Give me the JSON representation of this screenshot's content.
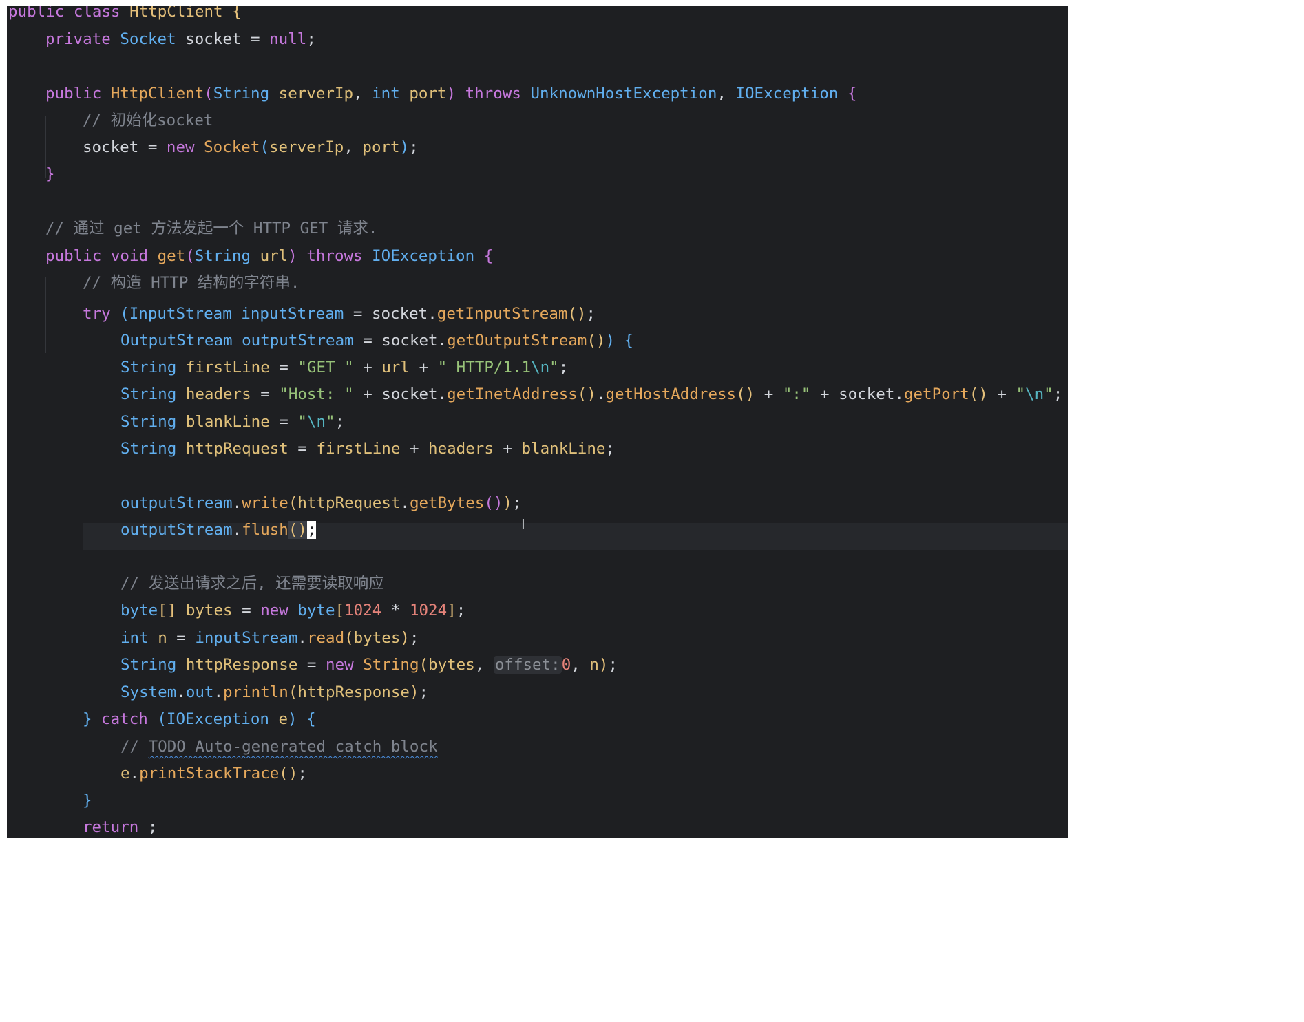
{
  "editor": {
    "theme": {
      "background": "#1e1f22",
      "keyword": "#c678dd",
      "type": "#61afef",
      "string": "#98c379",
      "comment": "#7f848e",
      "method": "#e5a85c"
    },
    "lines": [
      {
        "indent": 0,
        "tokens": [
          [
            "kw",
            "public"
          ],
          [
            "plain",
            " "
          ],
          [
            "kw",
            "class"
          ],
          [
            "plain",
            " "
          ],
          [
            "cls",
            "HttpClient"
          ],
          [
            "plain",
            " "
          ],
          [
            "br1",
            "{"
          ]
        ]
      },
      {
        "indent": 1,
        "tokens": [
          [
            "kw",
            "private"
          ],
          [
            "plain",
            " "
          ],
          [
            "ty",
            "Socket"
          ],
          [
            "plain",
            " socket = "
          ],
          [
            "kw",
            "null"
          ],
          [
            "plain",
            ";"
          ]
        ]
      },
      {
        "indent": 0,
        "tokens": []
      },
      {
        "indent": 1,
        "tokens": [
          [
            "kw",
            "public"
          ],
          [
            "plain",
            " "
          ],
          [
            "fn",
            "HttpClient"
          ],
          [
            "br2",
            "("
          ],
          [
            "ty",
            "String"
          ],
          [
            "plain",
            " "
          ],
          [
            "var",
            "serverIp"
          ],
          [
            "plain",
            ", "
          ],
          [
            "ty",
            "int"
          ],
          [
            "plain",
            " "
          ],
          [
            "var",
            "port"
          ],
          [
            "br2",
            ")"
          ],
          [
            "plain",
            " "
          ],
          [
            "kw",
            "throws"
          ],
          [
            "plain",
            " "
          ],
          [
            "ty",
            "UnknownHostException"
          ],
          [
            "plain",
            ", "
          ],
          [
            "ty",
            "IOException"
          ],
          [
            "plain",
            " "
          ],
          [
            "br2",
            "{"
          ]
        ]
      },
      {
        "indent": 2,
        "tokens": [
          [
            "cmt",
            "// 初始化socket"
          ]
        ]
      },
      {
        "indent": 2,
        "tokens": [
          [
            "plain",
            "socket = "
          ],
          [
            "kw",
            "new"
          ],
          [
            "plain",
            " "
          ],
          [
            "fn",
            "Socket"
          ],
          [
            "br3",
            "("
          ],
          [
            "var",
            "serverIp"
          ],
          [
            "plain",
            ", "
          ],
          [
            "var",
            "port"
          ],
          [
            "br3",
            ")"
          ],
          [
            "plain",
            ";"
          ]
        ]
      },
      {
        "indent": 1,
        "tokens": [
          [
            "br2",
            "}"
          ]
        ]
      },
      {
        "indent": 0,
        "tokens": []
      },
      {
        "indent": 1,
        "tokens": [
          [
            "cmt",
            "// 通过 get 方法发起一个 HTTP GET 请求."
          ]
        ]
      },
      {
        "indent": 1,
        "tokens": [
          [
            "kw",
            "public"
          ],
          [
            "plain",
            " "
          ],
          [
            "kw",
            "void"
          ],
          [
            "plain",
            " "
          ],
          [
            "fn",
            "get"
          ],
          [
            "br2",
            "("
          ],
          [
            "ty",
            "String"
          ],
          [
            "plain",
            " "
          ],
          [
            "var",
            "url"
          ],
          [
            "br2",
            ")"
          ],
          [
            "plain",
            " "
          ],
          [
            "kw",
            "throws"
          ],
          [
            "plain",
            " "
          ],
          [
            "ty",
            "IOException"
          ],
          [
            "plain",
            " "
          ],
          [
            "br2",
            "{"
          ]
        ]
      },
      {
        "indent": 2,
        "tokens": [
          [
            "cmt",
            "// 构造 HTTP 结构的字符串."
          ]
        ]
      },
      {
        "indent": 2,
        "tokens": [
          [
            "kw",
            "try"
          ],
          [
            "plain",
            " "
          ],
          [
            "br3",
            "("
          ],
          [
            "ty",
            "InputStream"
          ],
          [
            "plain",
            " "
          ],
          [
            "field",
            "inputStream"
          ],
          [
            "plain",
            " = socket."
          ],
          [
            "fn",
            "getInputStream"
          ],
          [
            "br1",
            "()"
          ],
          [
            "plain",
            ";"
          ]
        ]
      },
      {
        "indent": 3,
        "tokens": [
          [
            "ty",
            "OutputStream"
          ],
          [
            "plain",
            " "
          ],
          [
            "field",
            "outputStream"
          ],
          [
            "plain",
            " = socket."
          ],
          [
            "fn",
            "getOutputStream"
          ],
          [
            "br1",
            "()"
          ],
          [
            "br3",
            ")"
          ],
          [
            "plain",
            " "
          ],
          [
            "br3",
            "{"
          ]
        ]
      },
      {
        "indent": 3,
        "tokens": [
          [
            "ty",
            "String"
          ],
          [
            "plain",
            " "
          ],
          [
            "var",
            "firstLine"
          ],
          [
            "plain",
            " = "
          ],
          [
            "str",
            "\"GET \""
          ],
          [
            "plain",
            " + "
          ],
          [
            "var",
            "url"
          ],
          [
            "plain",
            " + "
          ],
          [
            "str",
            "\" HTTP/1.1"
          ],
          [
            "esc",
            "\\n"
          ],
          [
            "str",
            "\""
          ],
          [
            "plain",
            ";"
          ]
        ]
      },
      {
        "indent": 3,
        "tokens": [
          [
            "ty",
            "String"
          ],
          [
            "plain",
            " "
          ],
          [
            "var",
            "headers"
          ],
          [
            "plain",
            " = "
          ],
          [
            "str",
            "\"Host: \""
          ],
          [
            "plain",
            " + socket."
          ],
          [
            "fn",
            "getInetAddress"
          ],
          [
            "br1",
            "()"
          ],
          [
            "plain",
            "."
          ],
          [
            "fn",
            "getHostAddress"
          ],
          [
            "br1",
            "()"
          ],
          [
            "plain",
            " + "
          ],
          [
            "str",
            "\":\""
          ],
          [
            "plain",
            " + socket."
          ],
          [
            "fn",
            "getPort"
          ],
          [
            "br1",
            "()"
          ],
          [
            "plain",
            " + "
          ],
          [
            "str",
            "\""
          ],
          [
            "esc",
            "\\n"
          ],
          [
            "str",
            "\""
          ],
          [
            "plain",
            ";"
          ]
        ]
      },
      {
        "indent": 3,
        "tokens": [
          [
            "ty",
            "String"
          ],
          [
            "plain",
            " "
          ],
          [
            "var",
            "blankLine"
          ],
          [
            "plain",
            " = "
          ],
          [
            "str",
            "\""
          ],
          [
            "esc",
            "\\n"
          ],
          [
            "str",
            "\""
          ],
          [
            "plain",
            ";"
          ]
        ]
      },
      {
        "indent": 3,
        "tokens": [
          [
            "ty",
            "String"
          ],
          [
            "plain",
            " "
          ],
          [
            "var",
            "httpRequest"
          ],
          [
            "plain",
            " = "
          ],
          [
            "var",
            "firstLine"
          ],
          [
            "plain",
            " + "
          ],
          [
            "var",
            "headers"
          ],
          [
            "plain",
            " + "
          ],
          [
            "var",
            "blankLine"
          ],
          [
            "plain",
            ";"
          ]
        ]
      },
      {
        "indent": 0,
        "tokens": []
      },
      {
        "indent": 3,
        "tokens": [
          [
            "field",
            "outputStream"
          ],
          [
            "plain",
            "."
          ],
          [
            "fn",
            "write"
          ],
          [
            "br1",
            "("
          ],
          [
            "var",
            "httpRequest"
          ],
          [
            "plain",
            "."
          ],
          [
            "fn",
            "getBytes"
          ],
          [
            "br2",
            "()"
          ],
          [
            "br1",
            ")"
          ],
          [
            "plain",
            ";"
          ]
        ]
      },
      {
        "indent": 3,
        "current": true,
        "tokens": [
          [
            "field",
            "outputStream"
          ],
          [
            "plain",
            "."
          ],
          [
            "fn",
            "flush"
          ],
          [
            "match",
            "()"
          ],
          [
            "caret",
            ";"
          ]
        ]
      },
      {
        "indent": 0,
        "tokens": []
      },
      {
        "indent": 3,
        "tokens": [
          [
            "cmt",
            "// 发送出请求之后, 还需要读取响应"
          ]
        ]
      },
      {
        "indent": 3,
        "tokens": [
          [
            "ty",
            "byte"
          ],
          [
            "br1",
            "[]"
          ],
          [
            "plain",
            " "
          ],
          [
            "var",
            "bytes"
          ],
          [
            "plain",
            " = "
          ],
          [
            "kw",
            "new"
          ],
          [
            "plain",
            " "
          ],
          [
            "ty",
            "byte"
          ],
          [
            "br1",
            "["
          ],
          [
            "num",
            "1024"
          ],
          [
            "plain",
            " * "
          ],
          [
            "num",
            "1024"
          ],
          [
            "br1",
            "]"
          ],
          [
            "plain",
            ";"
          ]
        ]
      },
      {
        "indent": 3,
        "tokens": [
          [
            "ty",
            "int"
          ],
          [
            "plain",
            " "
          ],
          [
            "var",
            "n"
          ],
          [
            "plain",
            " = "
          ],
          [
            "field",
            "inputStream"
          ],
          [
            "plain",
            "."
          ],
          [
            "fn",
            "read"
          ],
          [
            "br1",
            "("
          ],
          [
            "var",
            "bytes"
          ],
          [
            "br1",
            ")"
          ],
          [
            "plain",
            ";"
          ]
        ]
      },
      {
        "indent": 3,
        "tokens": [
          [
            "ty",
            "String"
          ],
          [
            "plain",
            " "
          ],
          [
            "var",
            "httpResponse"
          ],
          [
            "plain",
            " = "
          ],
          [
            "kw",
            "new"
          ],
          [
            "plain",
            " "
          ],
          [
            "fn",
            "String"
          ],
          [
            "br1",
            "("
          ],
          [
            "var",
            "bytes"
          ],
          [
            "plain",
            ", "
          ],
          [
            "hint",
            "offset:"
          ],
          [
            "num",
            "0"
          ],
          [
            "plain",
            ", "
          ],
          [
            "var",
            "n"
          ],
          [
            "br1",
            ")"
          ],
          [
            "plain",
            ";"
          ]
        ]
      },
      {
        "indent": 3,
        "tokens": [
          [
            "ty",
            "System"
          ],
          [
            "plain",
            "."
          ],
          [
            "field",
            "out"
          ],
          [
            "plain",
            "."
          ],
          [
            "fn",
            "println"
          ],
          [
            "br1",
            "("
          ],
          [
            "var",
            "httpResponse"
          ],
          [
            "br1",
            ")"
          ],
          [
            "plain",
            ";"
          ]
        ]
      },
      {
        "indent": 2,
        "tokens": [
          [
            "br3",
            "}"
          ],
          [
            "plain",
            " "
          ],
          [
            "kw",
            "catch"
          ],
          [
            "plain",
            " "
          ],
          [
            "br3",
            "("
          ],
          [
            "ty",
            "IOException"
          ],
          [
            "plain",
            " "
          ],
          [
            "var",
            "e"
          ],
          [
            "br3",
            ")"
          ],
          [
            "plain",
            " "
          ],
          [
            "br3",
            "{"
          ]
        ]
      },
      {
        "indent": 3,
        "tokens": [
          [
            "cmt",
            "// "
          ],
          [
            "todo",
            "TODO Auto-generated catch block"
          ]
        ]
      },
      {
        "indent": 3,
        "tokens": [
          [
            "var",
            "e"
          ],
          [
            "plain",
            "."
          ],
          [
            "fn",
            "printStackTrace"
          ],
          [
            "br1",
            "()"
          ],
          [
            "plain",
            ";"
          ]
        ]
      },
      {
        "indent": 2,
        "tokens": [
          [
            "br3",
            "}"
          ]
        ]
      },
      {
        "indent": 2,
        "tokens": [
          [
            "kw",
            "return"
          ],
          [
            "plain",
            " ;"
          ]
        ]
      }
    ]
  }
}
